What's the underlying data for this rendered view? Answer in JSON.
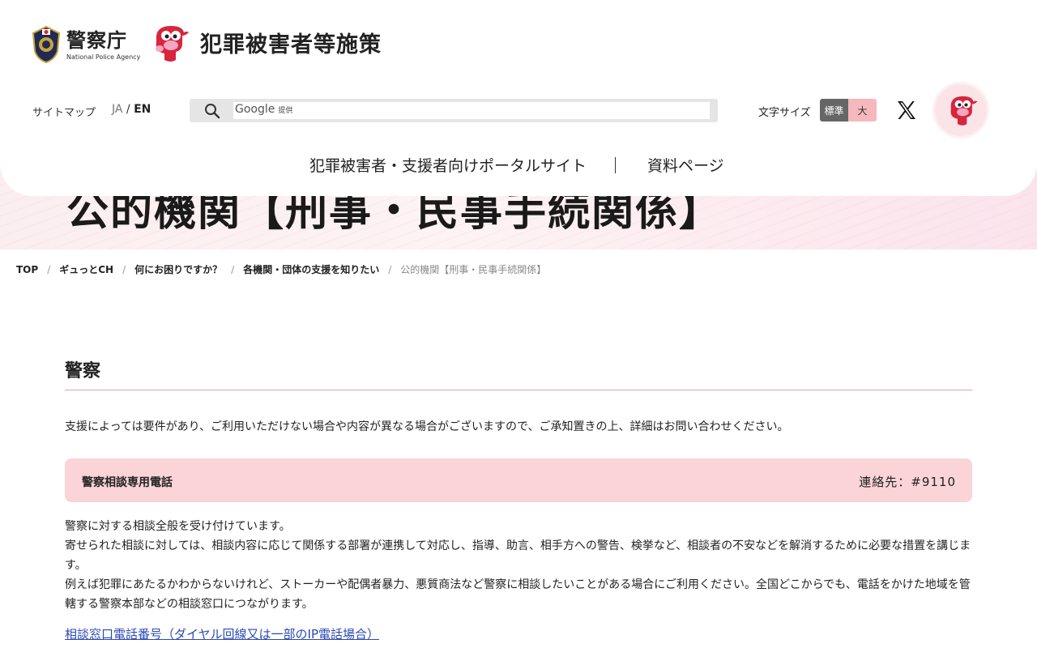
{
  "header": {
    "police_name": "警察庁",
    "police_en": "National Police Agency",
    "site_title": "犯罪被害者等施策",
    "sitemap": "サイトマップ",
    "lang_ja": "JA",
    "lang_sep": "/",
    "lang_en": "EN",
    "search_brand": "Google",
    "search_brand_note": "提供",
    "font_size_label": "文字サイズ",
    "font_size_standard": "標準",
    "font_size_large": "大",
    "nav": {
      "portal": "犯罪被害者・支援者向けポータルサイト",
      "docs": "資料ページ"
    }
  },
  "hero": {
    "title": "公的機関【刑事・民事手続関係】"
  },
  "breadcrumb": [
    "TOP",
    "ギュっとCH",
    "何にお困りですか？",
    "各機関・団体の支援を知りたい",
    "公的機関【刑事・民事手続関係】"
  ],
  "breadcrumb_sep": "/",
  "main": {
    "section_title": "警察",
    "notice": "支援によっては要件があり、ご利用いただけない場合や内容が異なる場合がございますので、ご承知置きの上、詳細はお問い合わせください。",
    "card": {
      "title": "警察相談専用電話",
      "contact": "連絡先：#9110"
    },
    "paragraphs": [
      "警察に対する相談全般を受け付けています。",
      "寄せられた相談に対しては、相談内容に応じて関係する部署が連携して対応し、指導、助言、相手方への警告、検挙など、相談者の不安などを解消するために必要な措置を講じます。",
      "例えば犯罪にあたるかわからないけれど、ストーカーや配偶者暴力、悪質商法など警察に相談したいことがある場合にご利用ください。全国どこからでも、電話をかけた地域を管轄する警察本部などの相談窓口につながります。"
    ],
    "link": "相談窓口電話番号（ダイヤル回線又は一部のIP電話場合）"
  },
  "colors": {
    "accent_pink": "#fad4d6",
    "font_std_bg": "#666666",
    "font_large_bg": "#f5b8bc",
    "link": "#2a4ab5"
  }
}
